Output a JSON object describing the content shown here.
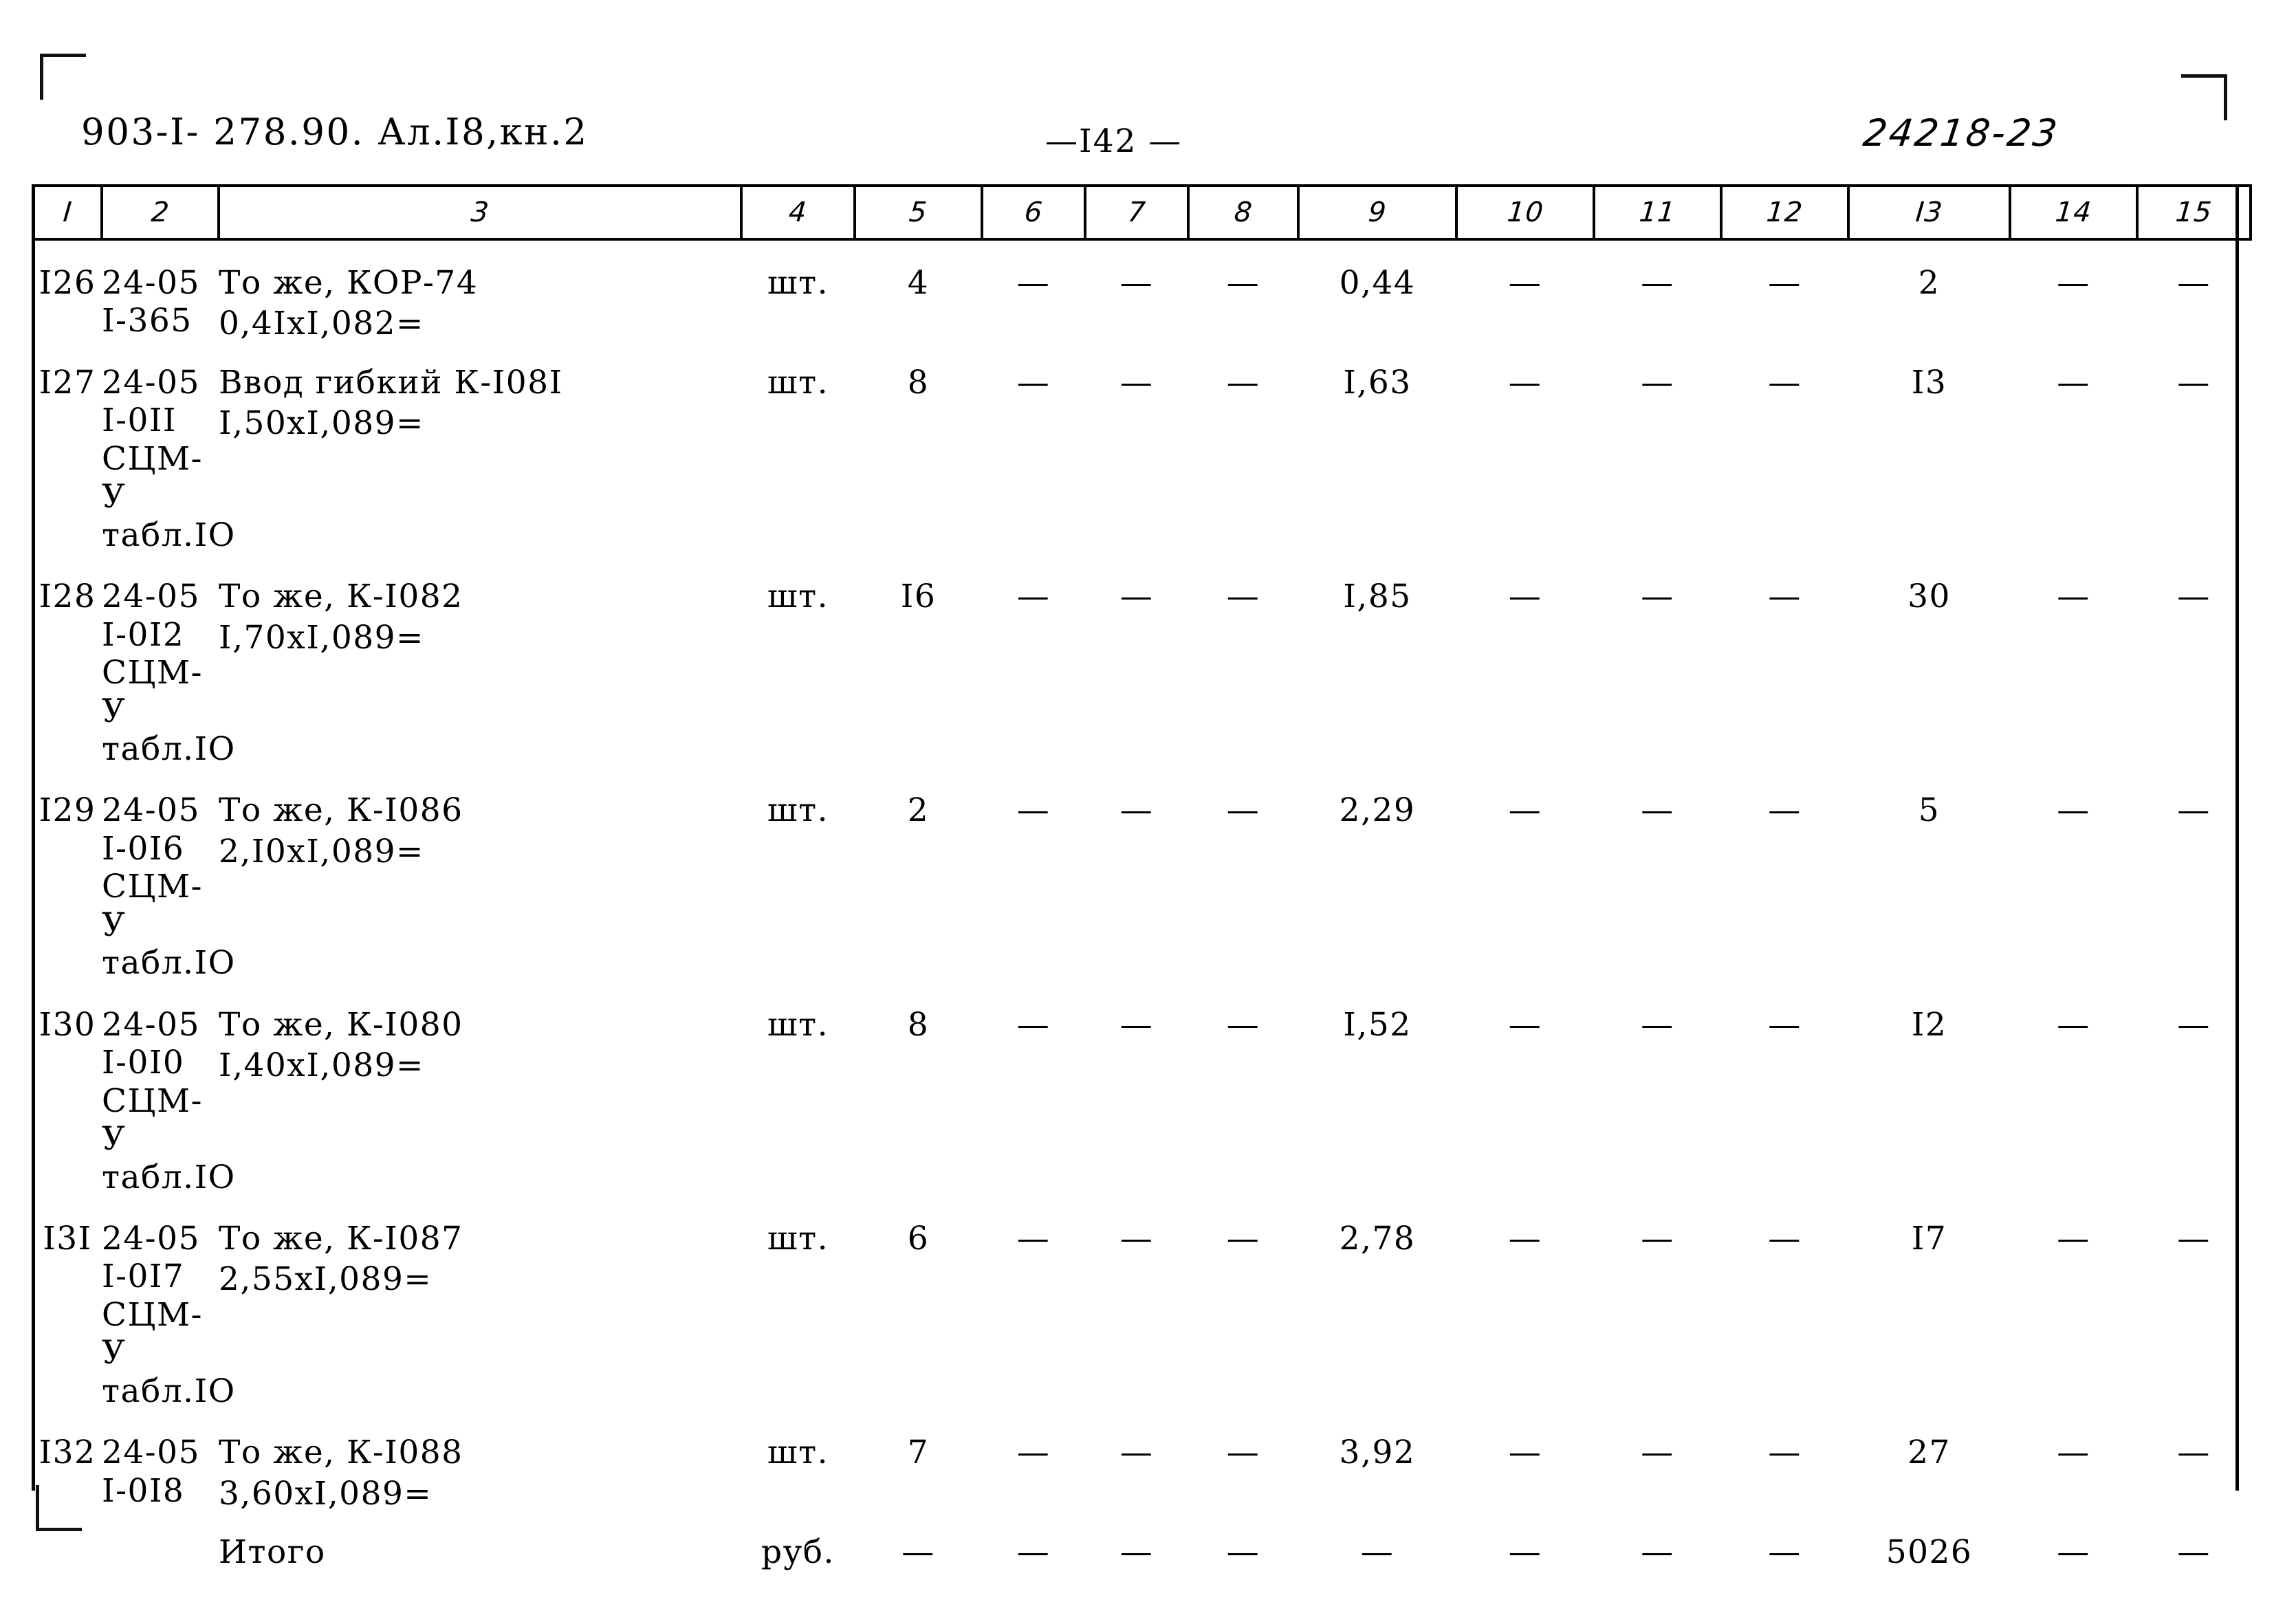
{
  "header": {
    "doc_code": "903-I- 278.90.  Ал.I8,кн.2",
    "page_number": "—I42 —",
    "stamp_code": "24218-23"
  },
  "table": {
    "column_headers": [
      "I",
      "2",
      "3",
      "4",
      "5",
      "6",
      "7",
      "8",
      "9",
      "10",
      "11",
      "12",
      "I3",
      "14",
      "15"
    ],
    "dash": "—",
    "rows": [
      {
        "num": "I26",
        "code": "24-05\nI-365",
        "desc": "То же, КОР-74",
        "desc2": "0,4IxI,082=",
        "unit": "шт.",
        "qty": "4",
        "c6": "—",
        "c7": "—",
        "c8": "—",
        "c9": "0,44",
        "c10": "—",
        "c11": "—",
        "c12": "—",
        "c13": "2",
        "c14": "—",
        "c15": "—"
      },
      {
        "num": "I27",
        "code": "24-05\nI-0II\nСЦМ-У\nтабл.IO",
        "desc": "Ввод гибкий К-I08I",
        "desc2": "I,50xI,089=",
        "unit": "шт.",
        "qty": "8",
        "c6": "—",
        "c7": "—",
        "c8": "—",
        "c9": "I,63",
        "c10": "—",
        "c11": "—",
        "c12": "—",
        "c13": "I3",
        "c14": "—",
        "c15": "—"
      },
      {
        "num": "I28",
        "code": "24-05\nI-0I2\nСЦМ-У\nтабл.IO",
        "desc": "То же, К-I082",
        "desc2": "I,70xI,089=",
        "unit": "шт.",
        "qty": "I6",
        "c6": "—",
        "c7": "—",
        "c8": "—",
        "c9": "I,85",
        "c10": "—",
        "c11": "—",
        "c12": "—",
        "c13": "30",
        "c14": "—",
        "c15": "—"
      },
      {
        "num": "I29",
        "code": "24-05\nI-0I6\nСЦМ-У\nтабл.IO",
        "desc": "То же, К-I086",
        "desc2": "2,I0xI,089=",
        "unit": "шт.",
        "qty": "2",
        "c6": "—",
        "c7": "—",
        "c8": "—",
        "c9": "2,29",
        "c10": "—",
        "c11": "—",
        "c12": "—",
        "c13": "5",
        "c14": "—",
        "c15": "—"
      },
      {
        "num": "I30",
        "code": "24-05\nI-0I0\nСЦМ-У\nтабл.IO",
        "desc": "То же, К-I080",
        "desc2": "I,40xI,089=",
        "unit": "шт.",
        "qty": "8",
        "c6": "—",
        "c7": "—",
        "c8": "—",
        "c9": "I,52",
        "c10": "—",
        "c11": "—",
        "c12": "—",
        "c13": "I2",
        "c14": "—",
        "c15": "—"
      },
      {
        "num": "I3I",
        "code": "24-05\nI-0I7\nСЦМ-У\nтабл.IO",
        "desc": "То же, К-I087",
        "desc2": "2,55xI,089=",
        "unit": "шт.",
        "qty": "6",
        "c6": "—",
        "c7": "—",
        "c8": "—",
        "c9": "2,78",
        "c10": "—",
        "c11": "—",
        "c12": "—",
        "c13": "I7",
        "c14": "—",
        "c15": "—"
      },
      {
        "num": "I32",
        "code": "24-05\nI-0I8",
        "desc": "То же, К-I088",
        "desc2": "3,60xI,089=",
        "unit": "шт.",
        "qty": "7",
        "c6": "—",
        "c7": "—",
        "c8": "—",
        "c9": "3,92",
        "c10": "—",
        "c11": "—",
        "c12": "—",
        "c13": "27",
        "c14": "—",
        "c15": "—"
      }
    ],
    "total_row": {
      "num": "",
      "code": "",
      "desc": "Итого",
      "desc2": "",
      "unit": "руб.",
      "qty": "—",
      "c6": "—",
      "c7": "—",
      "c8": "—",
      "c9": "—",
      "c10": "—",
      "c11": "—",
      "c12": "—",
      "c13": "5026",
      "c14": "—",
      "c15": "—"
    }
  }
}
